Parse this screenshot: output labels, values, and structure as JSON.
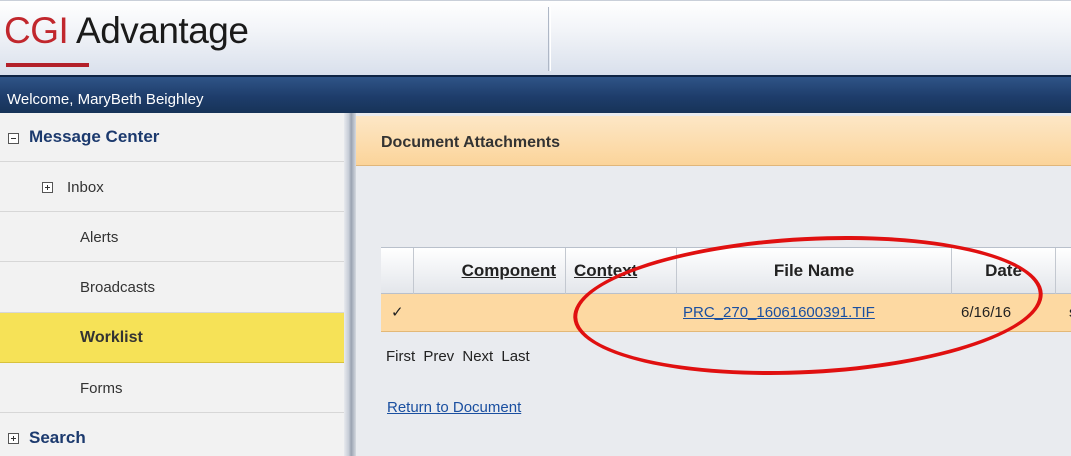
{
  "app": {
    "logo_cgi": "CGI",
    "logo_name": " Advantage",
    "welcome": "Welcome, MaryBeth Beighley"
  },
  "sidebar": {
    "items": [
      {
        "label": "Message Center",
        "icon": "minus-box-icon"
      },
      {
        "label": "Inbox",
        "icon": "plus-box-icon"
      },
      {
        "label": "Alerts"
      },
      {
        "label": "Broadcasts"
      },
      {
        "label": "Worklist",
        "active": true
      },
      {
        "label": "Forms"
      },
      {
        "label": "Search",
        "icon": "plus-box-icon"
      }
    ]
  },
  "panel": {
    "title": "Document Attachments"
  },
  "table": {
    "columns": [
      "Component",
      "Context",
      "File Name",
      "Date"
    ],
    "rows": [
      {
        "check": "✓",
        "component": "",
        "context": "",
        "file_name": "PRC_270_16061600391.TIF",
        "date": "6/16/16",
        "extra": "s"
      }
    ]
  },
  "pager": {
    "first": "First",
    "prev": "Prev",
    "next": "Next",
    "last": "Last"
  },
  "return_link": "Return to Document",
  "colors": {
    "accent_red": "#c1272d",
    "nav_blue": "#1e3d6b",
    "worklist_yellow": "#f6e257",
    "row_highlight": "#fdd9a2",
    "annotation_red": "#e01010"
  }
}
